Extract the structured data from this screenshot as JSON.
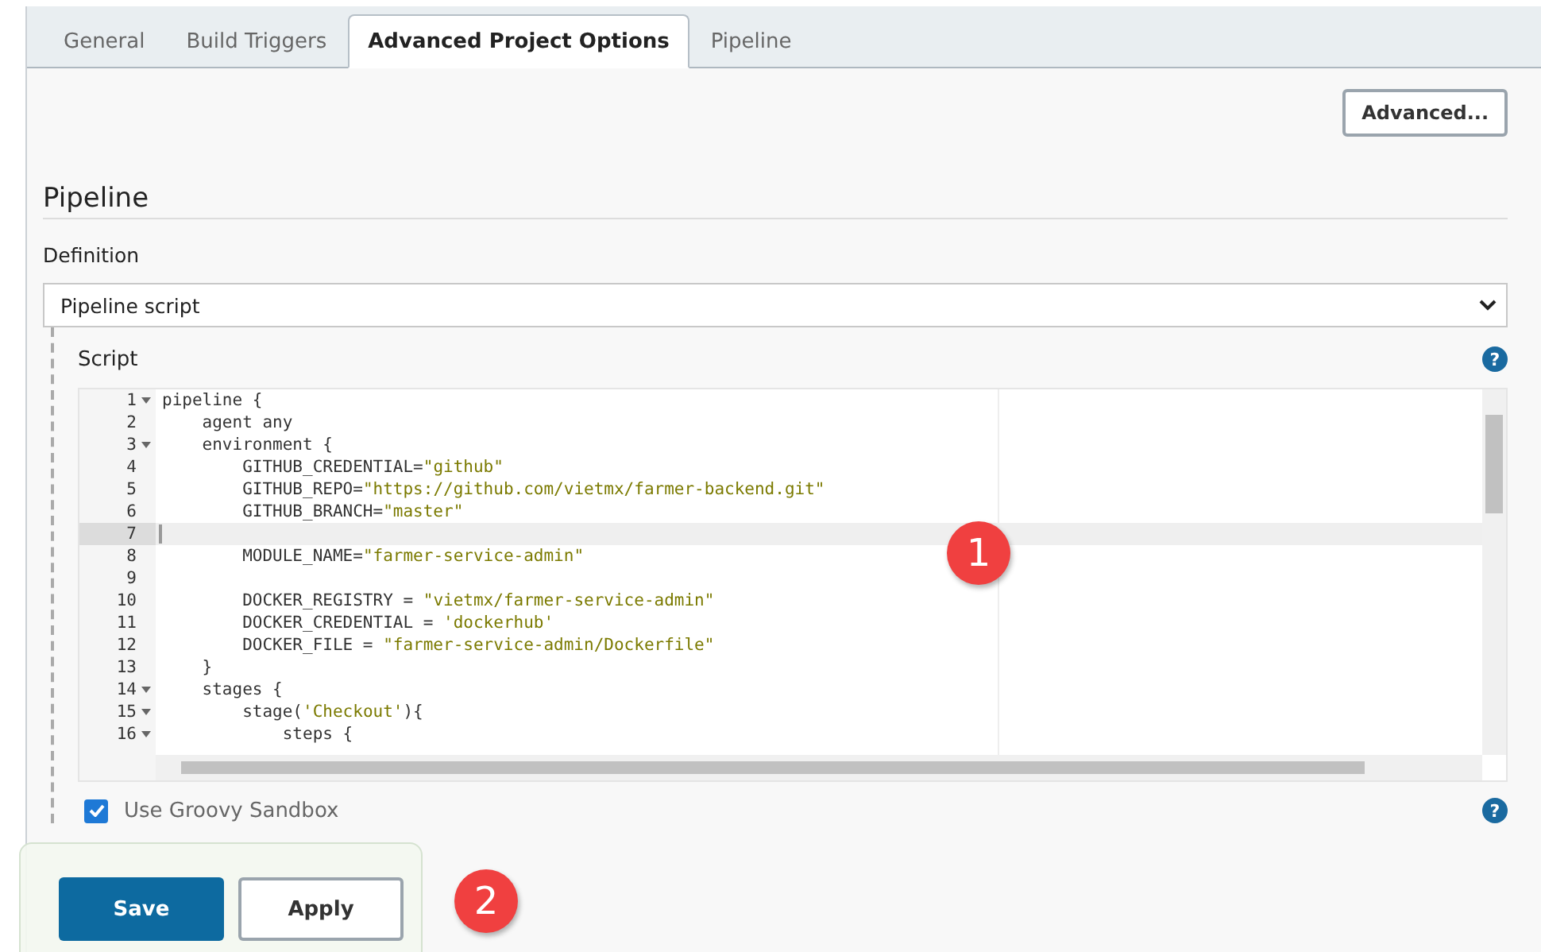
{
  "tabs": [
    {
      "label": "General",
      "selected": false
    },
    {
      "label": "Build Triggers",
      "selected": false
    },
    {
      "label": "Advanced Project Options",
      "selected": true
    },
    {
      "label": "Pipeline",
      "selected": false
    }
  ],
  "advanced_button": "Advanced...",
  "section_title": "Pipeline",
  "definition": {
    "label": "Definition",
    "value": "Pipeline script"
  },
  "script": {
    "label": "Script",
    "help": "?",
    "lines": [
      {
        "number": "1",
        "foldable": true,
        "current": false,
        "code": "pipeline {"
      },
      {
        "number": "2",
        "foldable": false,
        "current": false,
        "code": "    agent any"
      },
      {
        "number": "3",
        "foldable": true,
        "current": false,
        "code": "    environment {"
      },
      {
        "number": "4",
        "foldable": false,
        "current": false,
        "code": "        GITHUB_CREDENTIAL=\"github\""
      },
      {
        "number": "5",
        "foldable": false,
        "current": false,
        "code": "        GITHUB_REPO=\"https://github.com/vietmx/farmer-backend.git\""
      },
      {
        "number": "6",
        "foldable": false,
        "current": false,
        "code": "        GITHUB_BRANCH=\"master\""
      },
      {
        "number": "7",
        "foldable": false,
        "current": true
      },
      {
        "number": "8",
        "foldable": false,
        "current": false,
        "code": "        MODULE_NAME=\"farmer-service-admin\""
      },
      {
        "number": "9",
        "foldable": false,
        "current": false
      },
      {
        "number": "10",
        "foldable": false,
        "current": false,
        "code": "        DOCKER_REGISTRY = \"vietmx/farmer-service-admin\""
      },
      {
        "number": "11",
        "foldable": false,
        "current": false,
        "code": "        DOCKER_CREDENTIAL = 'dockerhub'"
      },
      {
        "number": "12",
        "foldable": false,
        "current": false,
        "code": "        DOCKER_FILE = \"farmer-service-admin/Dockerfile\""
      },
      {
        "number": "13",
        "foldable": false,
        "current": false,
        "code": "    }"
      },
      {
        "number": "14",
        "foldable": true,
        "current": false,
        "code": "    stages {"
      },
      {
        "number": "15",
        "foldable": true,
        "current": false,
        "code": "        stage('Checkout'){"
      },
      {
        "number": "16",
        "foldable": true,
        "current": false,
        "code": "            steps {"
      }
    ]
  },
  "sandbox": {
    "label": "Use Groovy Sandbox",
    "checked": true,
    "help": "?"
  },
  "buttons": [
    {
      "label": "Save",
      "kind": "primary"
    },
    {
      "label": "Apply",
      "kind": "secondary"
    }
  ],
  "callouts": [
    "1",
    "2"
  ]
}
